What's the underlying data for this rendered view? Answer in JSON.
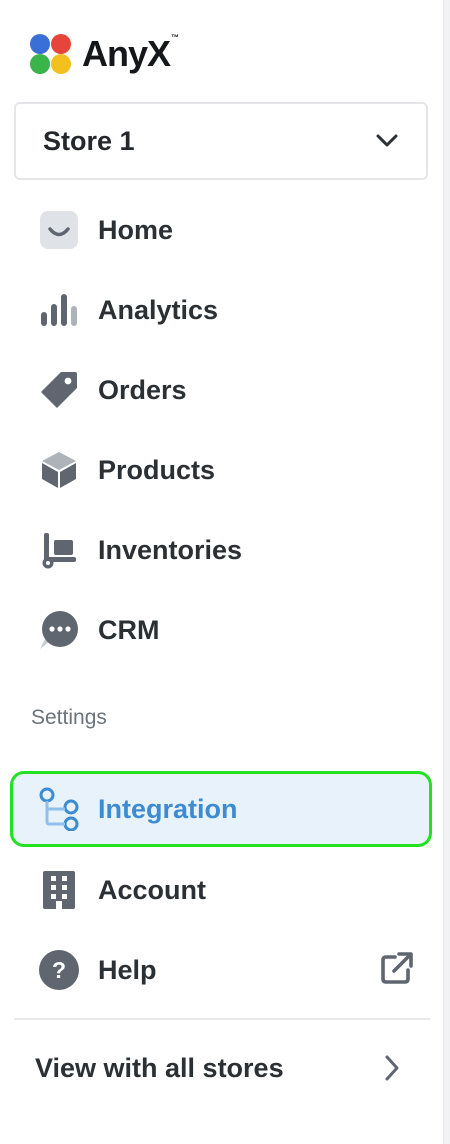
{
  "brand": {
    "name": "AnyX",
    "trademark": "™"
  },
  "store_selector": {
    "value": "Store 1",
    "icon": "chevron-down-icon"
  },
  "nav": {
    "items": [
      {
        "label": "Home",
        "icon": "home-icon"
      },
      {
        "label": "Analytics",
        "icon": "bar-chart-icon"
      },
      {
        "label": "Orders",
        "icon": "tag-icon"
      },
      {
        "label": "Products",
        "icon": "box-icon"
      },
      {
        "label": "Inventories",
        "icon": "hand-truck-icon"
      },
      {
        "label": "CRM",
        "icon": "chat-bubble-icon"
      }
    ]
  },
  "settings": {
    "title": "Settings",
    "items": [
      {
        "label": "Integration",
        "icon": "flow-icon",
        "active": true
      },
      {
        "label": "Account",
        "icon": "building-icon"
      },
      {
        "label": "Help",
        "icon": "help-circle-icon",
        "external_icon": "external-link-icon"
      }
    ]
  },
  "footer": {
    "label": "View with all stores",
    "icon": "chevron-right-icon"
  },
  "colors": {
    "active_bg": "#e8f2fb",
    "active_text": "#3d8bd0",
    "focus_outline": "#22e022",
    "icon_gray": "#5f6670",
    "logo_blue": "#3b6fd8",
    "logo_red": "#e5453b",
    "logo_green": "#3bb44a",
    "logo_yellow": "#f4c020"
  }
}
